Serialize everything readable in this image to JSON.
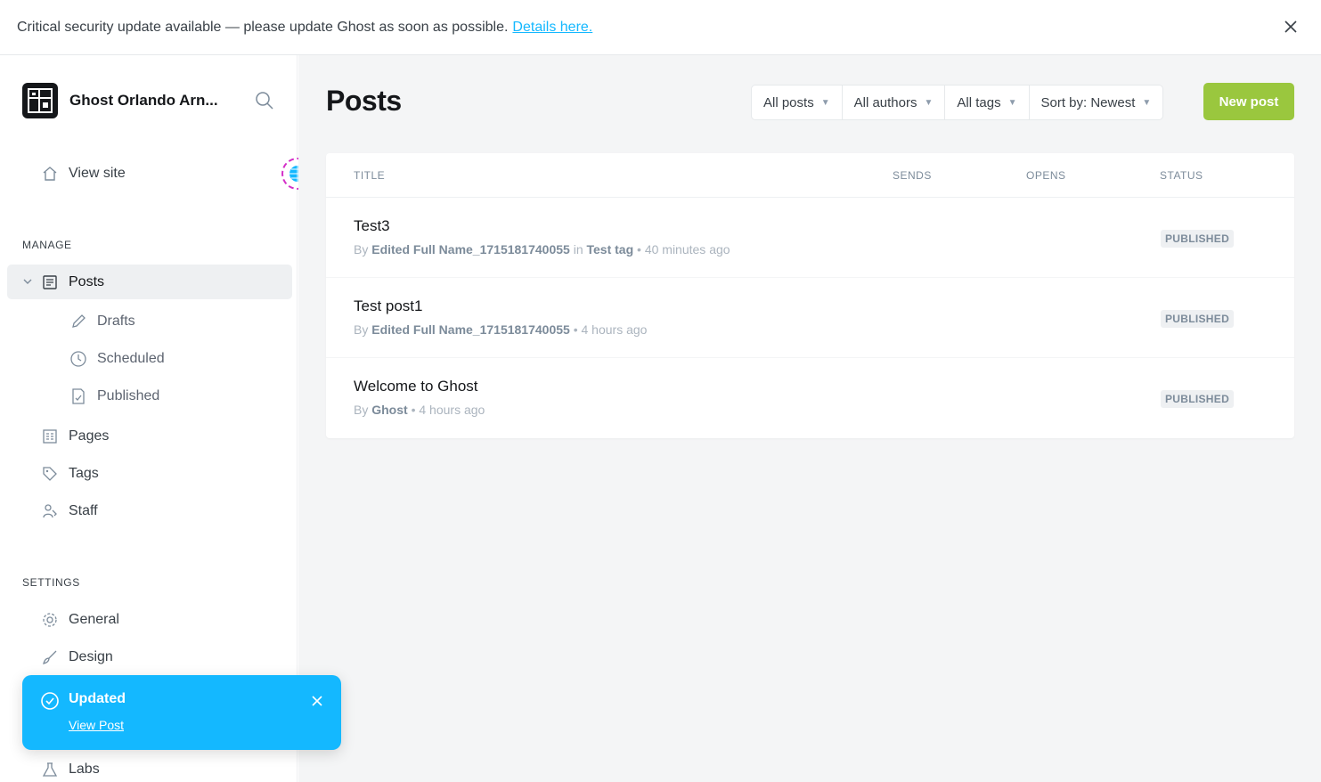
{
  "banner": {
    "text": "Critical security update available — please update Ghost as soon as possible.",
    "link": "Details here."
  },
  "sidebar": {
    "brand_name": "Ghost Orlando Arn...",
    "view_site": "View site",
    "manage_label": "MANAGE",
    "posts": "Posts",
    "drafts": "Drafts",
    "scheduled": "Scheduled",
    "published": "Published",
    "pages": "Pages",
    "tags": "Tags",
    "staff": "Staff",
    "settings_label": "SETTINGS",
    "general": "General",
    "design": "Design",
    "labs": "Labs"
  },
  "main": {
    "title": "Posts",
    "filters": {
      "posts": "All posts",
      "authors": "All authors",
      "tags": "All tags",
      "sort": "Sort by: Newest"
    },
    "new_post": "New post",
    "columns": {
      "title": "TITLE",
      "sends": "SENDS",
      "opens": "OPENS",
      "status": "STATUS"
    },
    "posts": [
      {
        "title": "Test3",
        "by": "By",
        "author": "Edited Full Name_1715181740055",
        "in": "in",
        "tag": "Test tag",
        "time": "• 40 minutes ago",
        "status": "PUBLISHED"
      },
      {
        "title": "Test post1",
        "by": "By",
        "author": "Edited Full Name_1715181740055",
        "time": "• 4 hours ago",
        "status": "PUBLISHED"
      },
      {
        "title": "Welcome to Ghost",
        "by": "By",
        "author": "Ghost",
        "time": "• 4 hours ago",
        "status": "PUBLISHED"
      }
    ]
  },
  "toast": {
    "title": "Updated",
    "link": "View Post"
  },
  "colors": {
    "accent_green": "#9ac73e",
    "toast_blue": "#14b8ff",
    "link_blue": "#14b8ff"
  }
}
